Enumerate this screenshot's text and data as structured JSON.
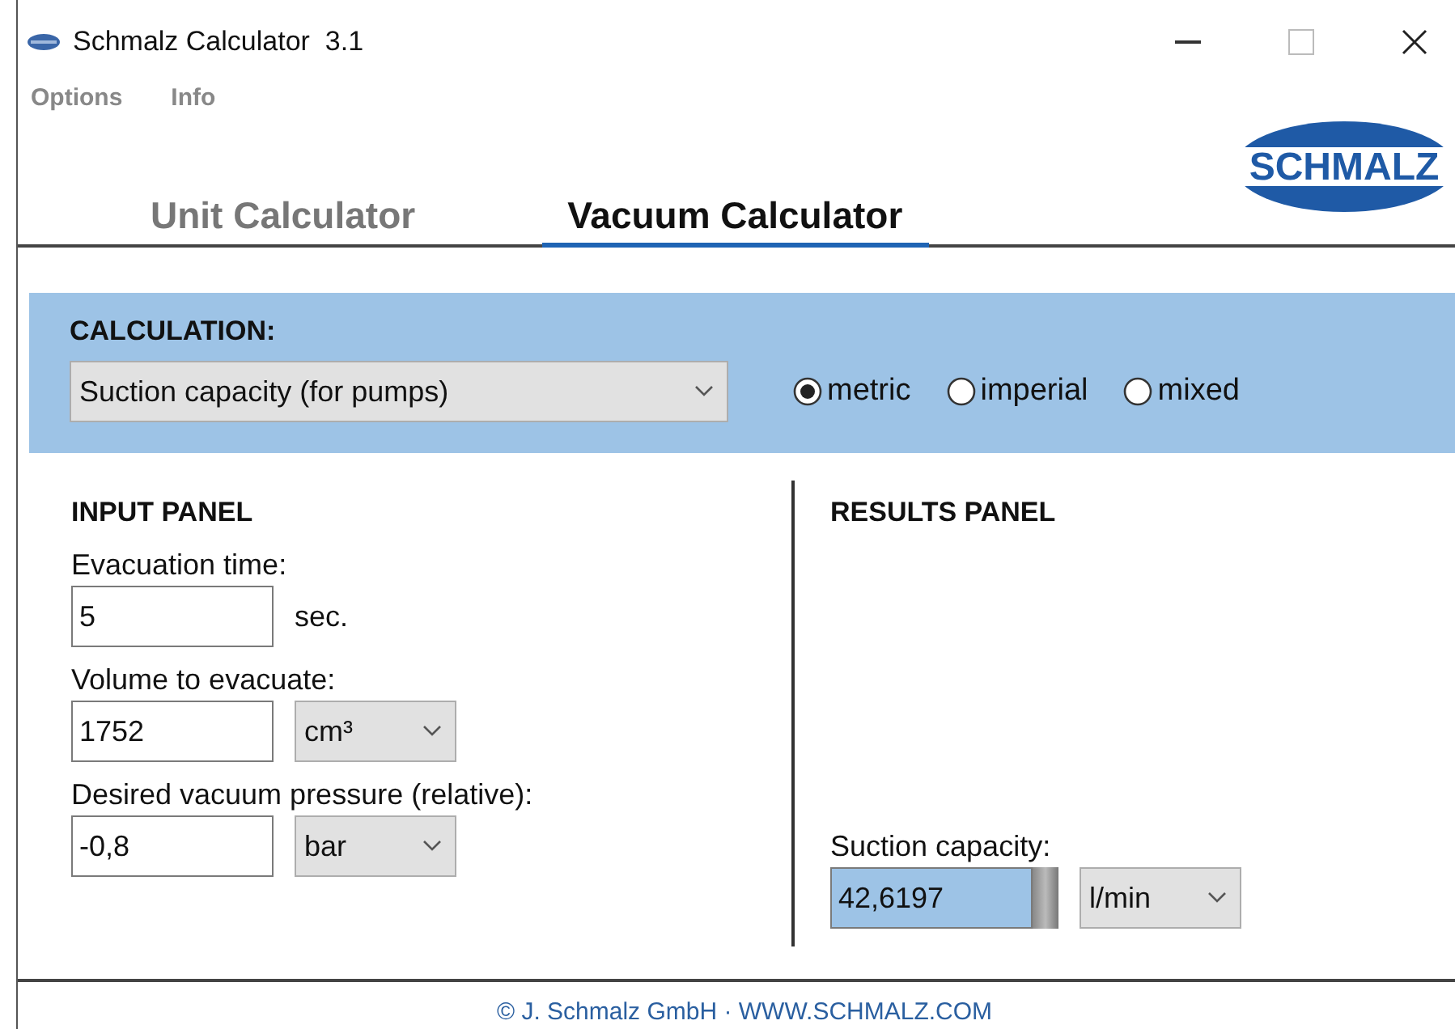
{
  "window": {
    "title": "Schmalz Calculator  3.1",
    "controls": [
      {
        "kind": "minimize"
      },
      {
        "kind": "maximize"
      },
      {
        "kind": "close"
      }
    ]
  },
  "menu": [
    {
      "label": "Options"
    },
    {
      "label": "Info"
    }
  ],
  "logo": {
    "text": "SCHMALZ"
  },
  "tabs": [
    {
      "label": "Unit Calculator",
      "selected": false
    },
    {
      "label": "Vacuum Calculator",
      "selected": true
    }
  ],
  "calculation": {
    "heading": "CALCULATION:",
    "value": "Suction capacity (for pumps)",
    "units": [
      {
        "label": "metric",
        "selected": true
      },
      {
        "label": "imperial",
        "selected": false
      },
      {
        "label": "mixed",
        "selected": false
      }
    ]
  },
  "input_panel": {
    "heading": "INPUT PANEL",
    "fields": [
      {
        "label": "Evacuation time:",
        "value": "5",
        "unit": "sec.",
        "kind": "text"
      },
      {
        "label": "Volume to evacuate:",
        "value": "1752",
        "unit": "cm³",
        "kind": "select"
      },
      {
        "label": "Desired vacuum pressure (relative):",
        "value": "-0,8",
        "unit": "bar",
        "kind": "select"
      }
    ]
  },
  "results_panel": {
    "heading": "RESULTS PANEL",
    "fields": [
      {
        "label": "Suction capacity:",
        "value": "42,6197",
        "unit": "l/min",
        "kind": "select",
        "highlighted": true
      }
    ]
  },
  "footer": {
    "text": "© J. Schmalz GmbH · WWW.SCHMALZ.COM"
  }
}
